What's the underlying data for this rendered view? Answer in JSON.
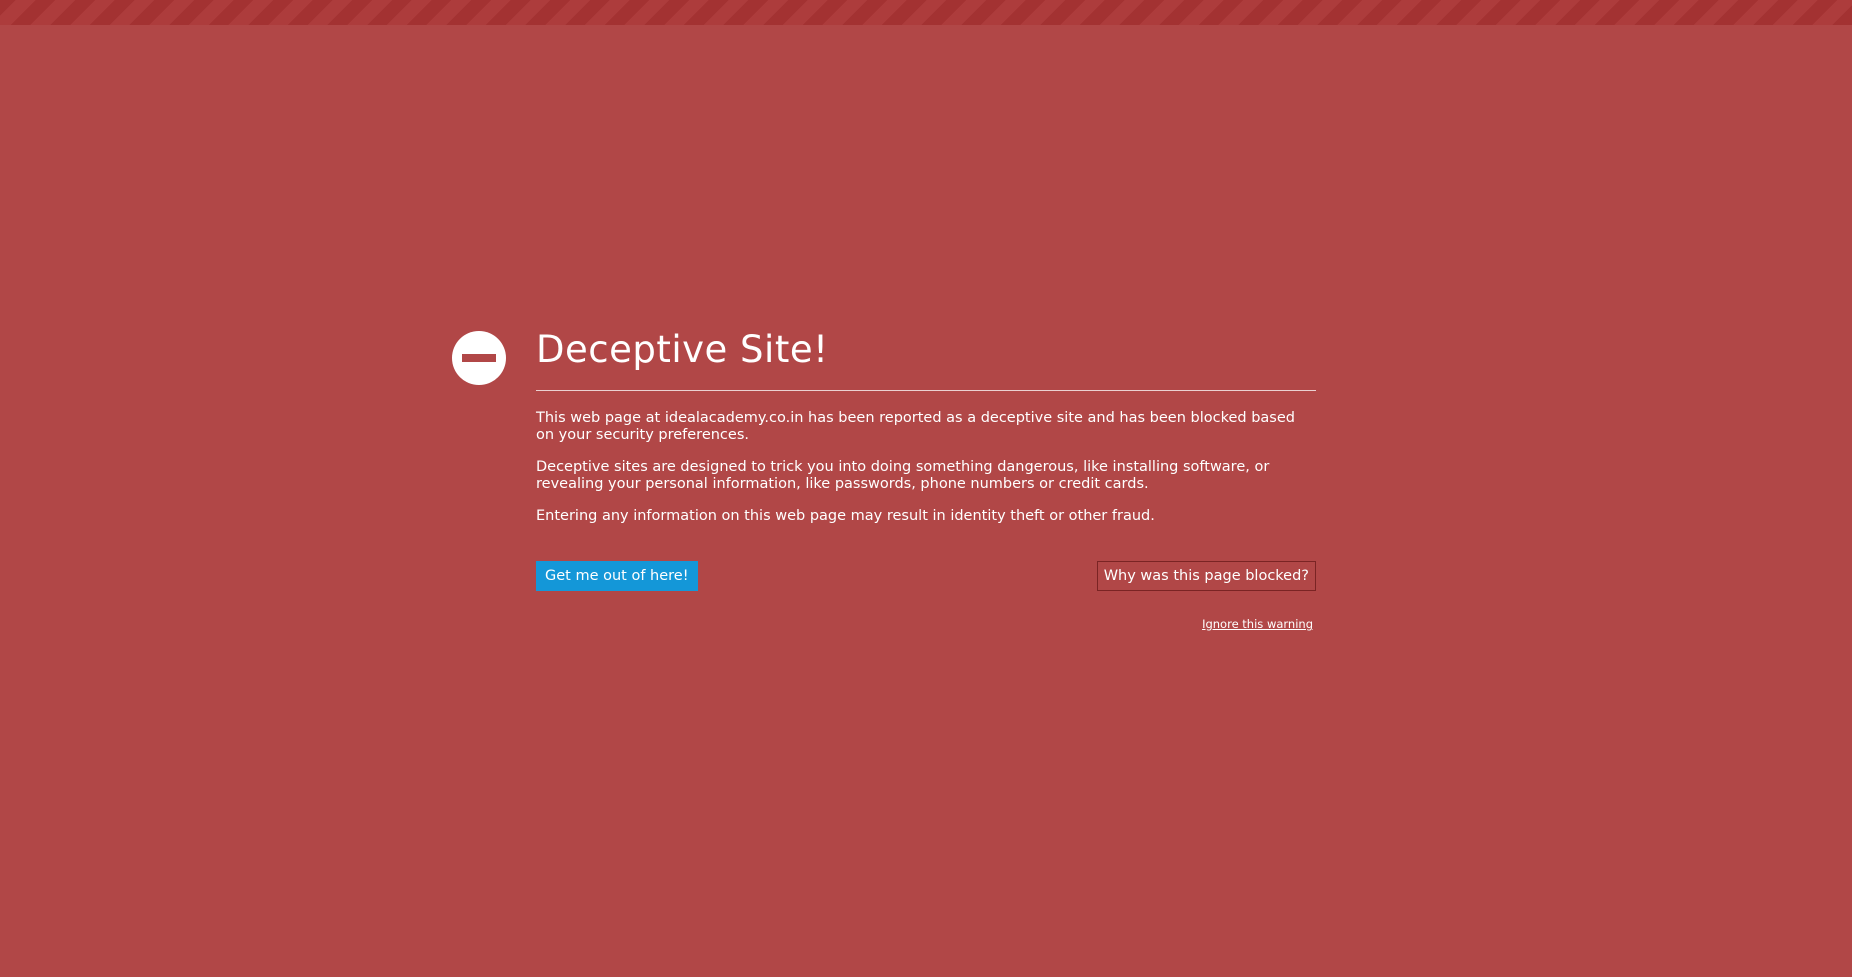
{
  "warning": {
    "title": "Deceptive Site!",
    "paragraphs": [
      "This web page at idealacademy.co.in has been reported as a deceptive site and has been blocked based on your security preferences.",
      "Deceptive sites are designed to trick you into doing something dangerous, like installing software, or revealing your personal information, like passwords, phone numbers or credit cards.",
      "Entering any information on this web page may result in identity theft or other fraud."
    ],
    "icon": "block-icon"
  },
  "actions": {
    "leave_label": "Get me out of here!",
    "why_blocked_label": "Why was this page blocked?",
    "ignore_label": "Ignore this warning"
  },
  "colors": {
    "background": "#b14747",
    "primary_button": "#1497d8",
    "text": "#ffffff"
  }
}
